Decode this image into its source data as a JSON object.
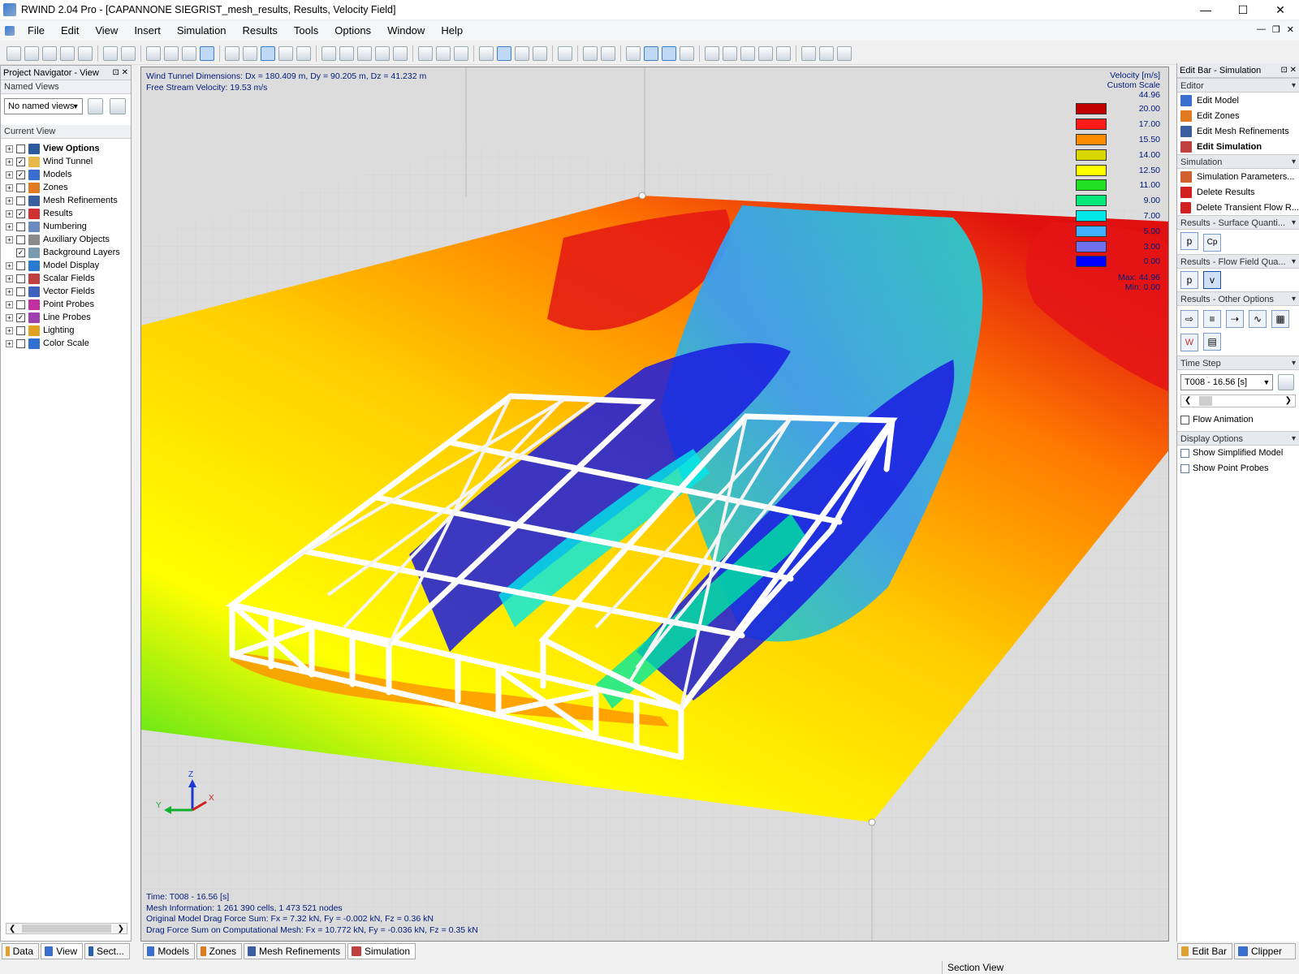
{
  "window": {
    "title": "RWIND 2.04 Pro - [CAPANNONE SIEGRIST_mesh_results, Results, Velocity Field]"
  },
  "menu": [
    "File",
    "Edit",
    "View",
    "Insert",
    "Simulation",
    "Results",
    "Tools",
    "Options",
    "Window",
    "Help"
  ],
  "navigator": {
    "title": "Project Navigator - View",
    "named_views_label": "Named Views",
    "named_views_value": "No named views",
    "current_view_label": "Current View",
    "tree": [
      {
        "label": "View Options",
        "checked": false,
        "bold": true,
        "icon": "view-options-icon",
        "color": "#2c5aa0"
      },
      {
        "label": "Wind Tunnel",
        "checked": true,
        "icon": "wind-tunnel-icon",
        "color": "#e8b94a"
      },
      {
        "label": "Models",
        "checked": true,
        "icon": "models-icon",
        "color": "#3a6fd0"
      },
      {
        "label": "Zones",
        "checked": false,
        "icon": "zones-icon",
        "color": "#e07a20"
      },
      {
        "label": "Mesh Refinements",
        "checked": false,
        "icon": "mesh-icon",
        "color": "#3a5fa0"
      },
      {
        "label": "Results",
        "checked": true,
        "icon": "results-icon",
        "color": "#d03030"
      },
      {
        "label": "Numbering",
        "checked": false,
        "icon": "numbering-icon",
        "color": "#6a8ac0"
      },
      {
        "label": "Auxiliary Objects",
        "checked": false,
        "icon": "auxiliary-icon",
        "color": "#8a8a8a"
      },
      {
        "label": "Background Layers",
        "checked": true,
        "icon": "background-icon",
        "color": "#7a9ab0"
      },
      {
        "label": "Model Display",
        "checked": false,
        "icon": "model-display-icon",
        "color": "#2a7ad0"
      },
      {
        "label": "Scalar Fields",
        "checked": false,
        "icon": "scalar-fields-icon",
        "color": "#c04040"
      },
      {
        "label": "Vector Fields",
        "checked": false,
        "icon": "vector-fields-icon",
        "color": "#4060c0"
      },
      {
        "label": "Point Probes",
        "checked": false,
        "icon": "point-probes-icon",
        "color": "#c030a0"
      },
      {
        "label": "Line Probes",
        "checked": true,
        "icon": "line-probes-icon",
        "color": "#a040b0"
      },
      {
        "label": "Lighting",
        "checked": false,
        "icon": "lighting-icon",
        "color": "#e0a020"
      },
      {
        "label": "Color Scale",
        "checked": false,
        "icon": "color-scale-icon",
        "color": "#3070d0"
      }
    ]
  },
  "view": {
    "info_top": [
      "Wind Tunnel Dimensions: Dx = 180.409 m, Dy = 90.205 m, Dz = 41.232 m",
      "Free Stream Velocity: 19.53 m/s"
    ],
    "info_bottom": [
      "Time: T008 - 16.56 [s]",
      "Mesh Information: 1 261 390 cells, 1 473 521 nodes",
      "Original Model Drag Force Sum: Fx = 7.32 kN, Fy = -0.002 kN, Fz = 0.36 kN",
      "Drag Force Sum on Computational Mesh: Fx = 10.772 kN, Fy = -0.036 kN, Fz = 0.35 kN"
    ],
    "legend": {
      "title": "Velocity [m/s]",
      "subtitle": "Custom Scale",
      "top_value": "44.96",
      "rows": [
        {
          "color": "#c00000",
          "value": "20.00"
        },
        {
          "color": "#ff1a1a",
          "value": "17.00"
        },
        {
          "color": "#ff8c00",
          "value": "15.50"
        },
        {
          "color": "#d8d800",
          "value": "14.00"
        },
        {
          "color": "#ffff00",
          "value": "12.50"
        },
        {
          "color": "#22e022",
          "value": "11.00"
        },
        {
          "color": "#00e87a",
          "value": "9.00"
        },
        {
          "color": "#00e8e8",
          "value": "7.00"
        },
        {
          "color": "#40b0ff",
          "value": "5.00"
        },
        {
          "color": "#7070f0",
          "value": "3.00"
        },
        {
          "color": "#0000ff",
          "value": "0.00"
        }
      ],
      "max": "Max:  44.96",
      "min": "Min:    0.00"
    },
    "axes": {
      "z": "Z",
      "y": "Y",
      "x": "X"
    }
  },
  "editbar": {
    "title": "Edit Bar - Simulation",
    "editor_label": "Editor",
    "editor_items": [
      {
        "label": "Edit Model",
        "color": "#3a6fd0"
      },
      {
        "label": "Edit Zones",
        "color": "#e07a20"
      },
      {
        "label": "Edit Mesh Refinements",
        "color": "#3a5fa0"
      },
      {
        "label": "Edit Simulation",
        "color": "#c04040",
        "bold": true
      }
    ],
    "simulation_label": "Simulation",
    "simulation_items": [
      {
        "label": "Simulation Parameters...",
        "color": "#d06030"
      },
      {
        "label": "Delete Results",
        "color": "#d02020"
      },
      {
        "label": "Delete Transient Flow R...",
        "color": "#d02020"
      }
    ],
    "surface_label": "Results - Surface Quanti...",
    "surface_buttons": [
      "p",
      "Cp"
    ],
    "flow_label": "Results - Flow Field Qua...",
    "flow_buttons": [
      "p",
      "v"
    ],
    "other_label": "Results - Other Options",
    "timestep_label": "Time Step",
    "timestep_value": "T008 - 16.56 [s]",
    "flow_animation": "Flow Animation",
    "display_label": "Display Options",
    "display_items": [
      "Show Simplified Model",
      "Show Point Probes"
    ]
  },
  "bottom_tabs": {
    "left": [
      "Data",
      "View",
      "Sect..."
    ],
    "center": [
      "Models",
      "Zones",
      "Mesh Refinements",
      "Simulation"
    ],
    "right": [
      "Edit Bar",
      "Clipper"
    ]
  },
  "status": {
    "section_view": "Section View"
  }
}
